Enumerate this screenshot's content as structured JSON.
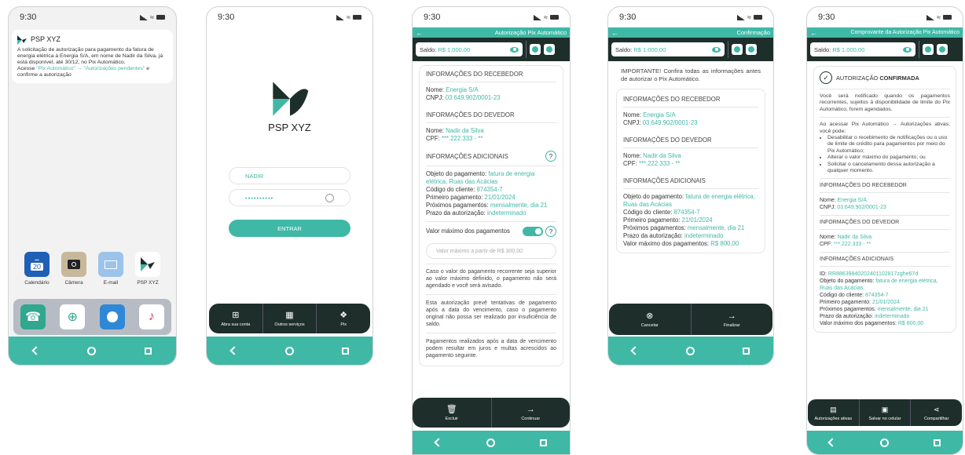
{
  "status_time": "9:30",
  "screen1": {
    "notification": {
      "app_name": "PSP XYZ",
      "body": "A solicitação de autorização para pagamento da fatura de energia elétrica à Energia S/A, em nome de Nadir da Silva, já está disponível, até 30/12, no Pix Automático.",
      "action_prefix": "Acesse",
      "link1": "\"Pix Automático\"",
      "arrow": "→",
      "link2": "\"Autorizações pendentes\"",
      "action_suffix": "e confirme a autorização"
    },
    "apps": [
      {
        "label": "Calendário",
        "icon": "calendar-icon",
        "text": "20"
      },
      {
        "label": "Câmera",
        "icon": "camera-icon"
      },
      {
        "label": "E-mail",
        "icon": "mail-icon"
      },
      {
        "label": "PSP XYZ",
        "icon": "psp-logo-icon"
      }
    ],
    "dock": [
      "phone-icon",
      "globe-icon",
      "browser-icon",
      "music-icon"
    ]
  },
  "screen2": {
    "logo_text": "PSP XYZ",
    "username": "NADIR",
    "password": "••••••••••",
    "login_button": "ENTRAR",
    "bottom_items": [
      {
        "icon": "add-icon",
        "label": "Abra sua conta"
      },
      {
        "icon": "grid-icon",
        "label": "Outros serviços"
      },
      {
        "icon": "pix-icon",
        "label": "Pix"
      }
    ]
  },
  "screen3": {
    "header_title": "Autorização Pix Automático",
    "saldo_label": "Saldo:",
    "saldo_value": "R$ 1.000,00",
    "receiver_title": "INFORMAÇÕES DO RECEBEDOR",
    "receiver_name_label": "Nome:",
    "receiver_name": "Energia S/A",
    "receiver_cnpj_label": "CNPJ:",
    "receiver_cnpj": "03.649.902/0001-23",
    "debtor_title": "INFORMAÇÕES DO DEVEDOR",
    "debtor_name_label": "Nome:",
    "debtor_name": "Nadir da Silva",
    "debtor_cpf_label": "CPF:",
    "debtor_cpf": "***.222.333 - **",
    "extra_title": "INFORMAÇÕES ADICIONAIS",
    "object_label": "Objeto do pagamento:",
    "object_value": "fatura de energia elétrica, Ruas das Acácias",
    "client_code_label": "Código do cliente:",
    "client_code": "874354-7",
    "first_payment_label": "Primeiro pagamento:",
    "first_payment": "21/01/2024",
    "next_payments_label": "Próximos pagamentos:",
    "next_payments": "mensalmente, dia 21",
    "term_label": "Prazo da autorização:",
    "term": "indeterminado",
    "max_label": "Valor máximo dos pagamentos",
    "max_placeholder": "Valor máximo a partir de R$ 300,00",
    "para1": "Caso o valor do pagamento recorrente seja superior ao valor máximo definido, o pagamento não será agendado e você será avisado.",
    "para2": "Esta autorização prevê tentativas de pagamento após a data do vencimento, caso o pagamento original não possa ser realizado por insuficiência de saldo.",
    "para3": "Pagamentos realizados após a data de vencimento podem resultar em juros e multas acrescidos ao pagamento seguinte.",
    "btn_delete": "Excluir",
    "btn_continue": "Continuar"
  },
  "screen4": {
    "header_title": "Confirmação",
    "saldo_label": "Saldo:",
    "saldo_value": "R$ 1.000,00",
    "important": "IMPORTANTE! Confira todas as informações antes de autorizar o Pix Automático.",
    "receiver_title": "INFORMAÇÕES DO RECEBEDOR",
    "receiver_name_label": "Nome:",
    "receiver_name": "Energia S/A",
    "receiver_cnpj_label": "CNPJ:",
    "receiver_cnpj": "03.649.902/0001-23",
    "debtor_title": "INFORMAÇÕES DO DEVEDOR",
    "debtor_name_label": "Nome:",
    "debtor_name": "Nadir da Silva",
    "debtor_cpf_label": "CPF:",
    "debtor_cpf": "***.222.333 - **",
    "extra_title": "INFORMAÇÕES ADICIONAIS",
    "object_label": "Objeto do pagamento:",
    "object_value": "fatura de energia elétrica, Ruas das Acácias",
    "client_code_label": "Código do cliente:",
    "client_code": "874354-7",
    "first_payment_label": "Primeiro pagamento:",
    "first_payment": "21/01/2024",
    "next_payments_label": "Próximos pagamentos:",
    "next_payments": "mensalmente, dia 21",
    "term_label": "Prazo da autorização:",
    "term": "indeterminado",
    "max_label": "Valor máximo dos pagamentos:",
    "max_value": "R$ 800,00",
    "btn_cancel": "Cancelar",
    "btn_finish": "Finalizar"
  },
  "screen5": {
    "header_title": "Comprovante da Autorização Pix Automático",
    "saldo_label": "Saldo:",
    "saldo_value": "R$ 1.000,00",
    "confirmed_prefix": "AUTORIZAÇÃO",
    "confirmed_word": "CONFIRMADA",
    "notice": "Você será notificado quando os pagamentos recorrentes, sujeitos à disponibilidade de limite do Pix Automático, forem agendados.",
    "access_intro": "Ao acessar Pix Automático → Autorizações ativas, você pode:",
    "bullets": [
      "Desabilitar o recebimento de notificações ou o uso de limite de crédito para pagamentos por meio do Pix Automático;",
      "Alterar o valor máximo do pagamento; ou",
      "Solicitar o cancelamento dessa autorização a qualquer momento."
    ],
    "receiver_title": "INFORMAÇÕES DO RECEBEDOR",
    "receiver_name_label": "Nome:",
    "receiver_name": "Energia S/A",
    "receiver_cnpj_label": "CNPJ:",
    "receiver_cnpj": "03.649.902/0001-23",
    "debtor_title": "INFORMAÇÕES DO DEVEDOR",
    "debtor_name_label": "Nome:",
    "debtor_name": "Nadir da Silva",
    "debtor_cpf_label": "CPF:",
    "debtor_cpf": "***.222.333 - **",
    "extra_title": "INFORMAÇÕES ADICIONAIS",
    "id_label": "ID:",
    "id_value": "RR88639840202401102817zghe67d",
    "object_label": "Objeto do pagamento:",
    "object_value": "fatura de energia elétrica, Ruas das Acácias.",
    "client_code_label": "Código do cliente:",
    "client_code": "874354-7",
    "first_payment_label": "Primeiro pagamento:",
    "first_payment": "21/01/2024",
    "next_payments_label": "Próximos pagamentos:",
    "next_payments": "mensalmente, dia 21",
    "term_label": "Prazo da autorização:",
    "term": "indeterminado",
    "max_label": "Valor máximo dos pagamentos:",
    "max_value": "R$ 800,00",
    "btn_active": "Autorizações ativas",
    "btn_save": "Salvar no celular",
    "btn_share": "Compartilhar"
  },
  "colors": {
    "accent": "#3fb8a6",
    "dark": "#1e2e2a"
  }
}
